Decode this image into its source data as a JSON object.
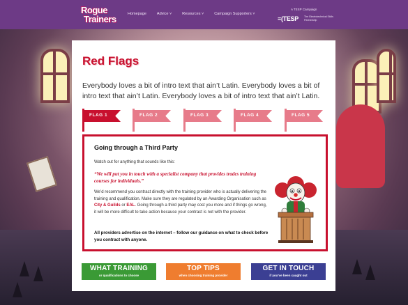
{
  "header": {
    "logo_line1": "Rogue",
    "logo_line2": "Trainers",
    "nav": [
      "Homepage",
      "Advice ˅",
      "Resources ˅",
      "Campaign Supporters ˅"
    ],
    "campaign_label": "A TESP Campaign",
    "tesp_mark": "≡(TESP",
    "tesp_sub": "The Electrotechnical Skills Partnership"
  },
  "page": {
    "title": "Red Flags",
    "intro": "Everybody loves a bit of intro text that ain’t Latin. Everybody loves a bit of intro text that ain’t Latin. Everybody loves a bit of intro text that ain’t Latin."
  },
  "flags": [
    "FLAG 1",
    "FLAG 2",
    "FLAG 3",
    "FLAG 4",
    "FLAG 5"
  ],
  "active_flag": 0,
  "panel": {
    "title": "Going through a Third Party",
    "lead": "Watch out for anything that sounds like this:",
    "quote": "“We will put you in touch with a specialist company that provides trades training courses for individuals.”",
    "body_1": "We’d recommend you contract directly with the training provider who is actually delivering the training and qualification. Make sure they are regulated by an Awarding Organisation such as ",
    "link_1": "City & Guilds",
    "body_2": " or ",
    "link_2": "EAL",
    "body_3": ". Going through a third party may cost you more and if things go wrong, it will be more difficult to take action because your contract is not with the provider.",
    "strong": "All providers advertise on the internet – follow our guidance on what to check before you contract with anyone."
  },
  "buttons": [
    {
      "title": "WHAT TRAINING",
      "subtitle": "or qualifications to choose",
      "color": "#3a9a35"
    },
    {
      "title": "TOP TIPS",
      "subtitle": "when choosing training provider",
      "color": "#ef7d2f"
    },
    {
      "title": "GET IN TOUCH",
      "subtitle": "if you’ve been caught out",
      "color": "#3b3f93"
    }
  ],
  "colors": {
    "brand_purple": "#6d3a86",
    "accent_red": "#c8102e",
    "flag_inactive": "#e77b8a"
  },
  "icons": {
    "illustration": "clown-at-podium"
  }
}
